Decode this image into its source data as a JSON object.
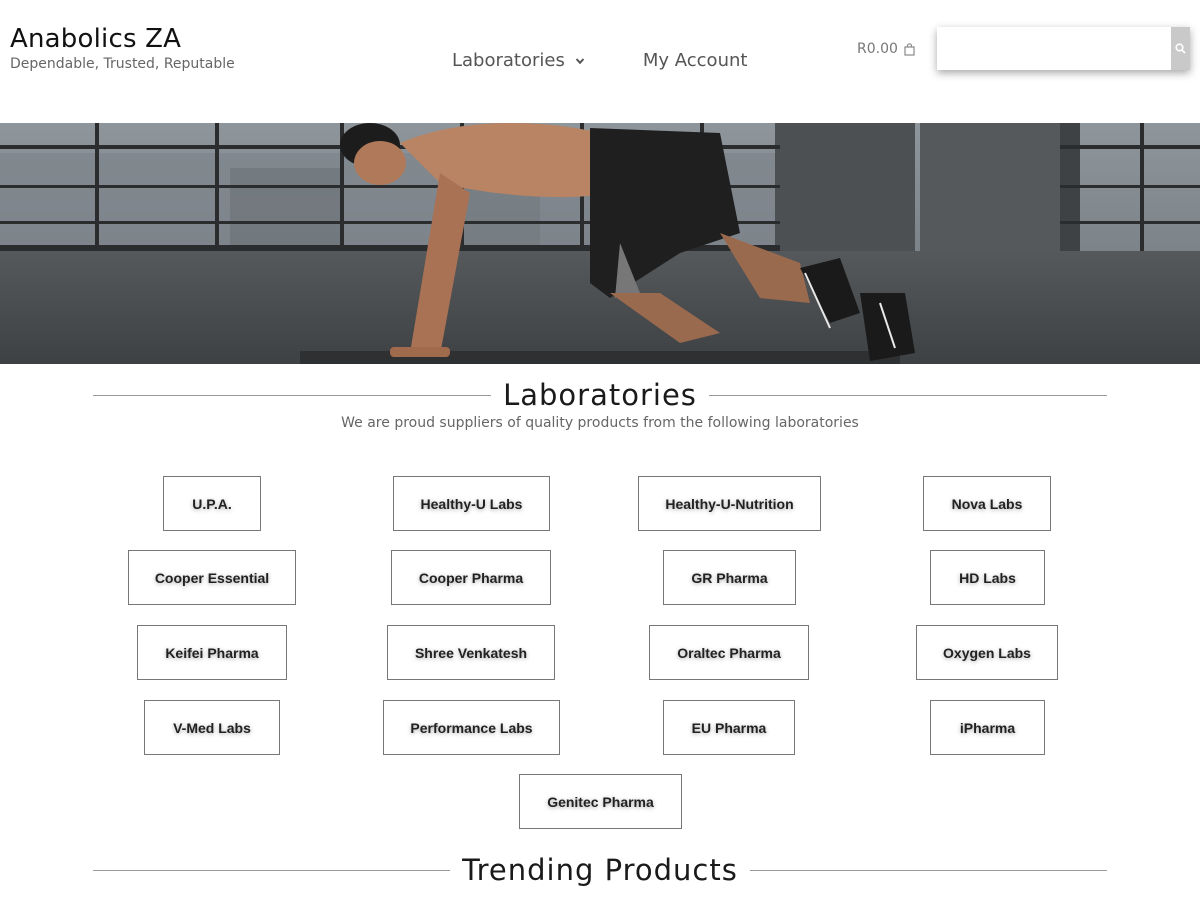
{
  "header": {
    "site_title": "Anabolics ZA",
    "tagline": "Dependable, Trusted, Reputable",
    "nav": [
      {
        "label": "Laboratories"
      },
      {
        "label": "My Account"
      }
    ],
    "cart_total": "R0.00",
    "search_placeholder": ""
  },
  "hero": {
    "image": "man-doing-mountain-climbers-photo"
  },
  "labs_section": {
    "title": "Laboratories",
    "subtitle": "We are proud suppliers of quality products from the following laboratories",
    "labs": [
      "U.P.A.",
      "Healthy-U Labs",
      "Healthy-U-Nutrition",
      "Nova Labs",
      "Cooper Essential",
      "Cooper Pharma",
      "GR Pharma",
      "HD Labs",
      "Keifei Pharma",
      "Shree Venkatesh",
      "Oraltec Pharma",
      "Oxygen Labs",
      "V-Med Labs",
      "Performance Labs",
      "EU Pharma",
      "iPharma",
      "Genitec Pharma"
    ]
  },
  "trending_section": {
    "title": "Trending Products"
  },
  "colors": {
    "text_dark": "#111111",
    "text_muted": "#666666",
    "border": "#777777",
    "search_button": "#c9c9c9"
  }
}
